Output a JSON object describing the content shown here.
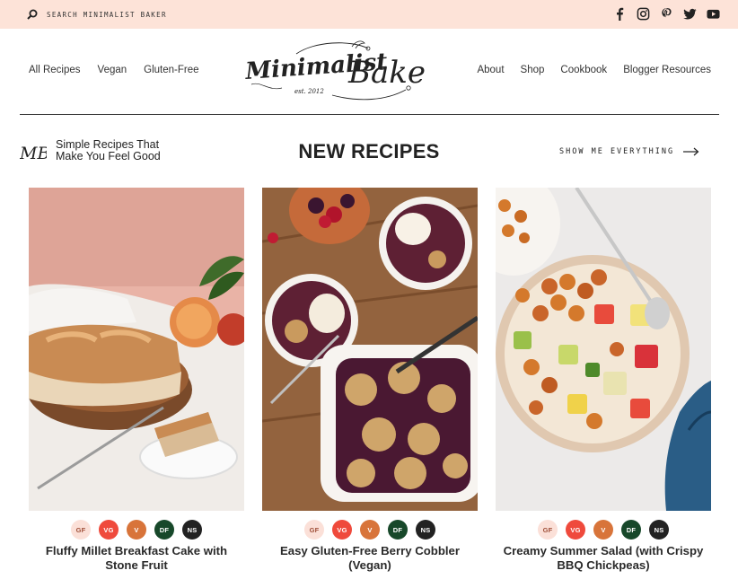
{
  "topbar": {
    "search_placeholder": "SEARCH MINIMALIST BAKER",
    "social": [
      {
        "name": "facebook-icon"
      },
      {
        "name": "instagram-icon"
      },
      {
        "name": "pinterest-icon"
      },
      {
        "name": "twitter-icon"
      },
      {
        "name": "youtube-icon"
      }
    ],
    "background_color": "#fde3d8"
  },
  "nav": {
    "left": [
      "All Recipes",
      "Vegan",
      "Gluten-Free"
    ],
    "right": [
      "About",
      "Shop",
      "Cookbook",
      "Blogger Resources"
    ]
  },
  "logo": {
    "word1": "Minimalist",
    "word2": "Baker",
    "est": "est. 2012"
  },
  "section": {
    "mark": "MB",
    "tagline_line1": "Simple Recipes That",
    "tagline_line2": "Make You Feel Good",
    "title": "NEW RECIPES",
    "show_all": "SHOW ME EVERYTHING"
  },
  "badge_colors": {
    "GF": "#fbe0d8",
    "VG": "#ef4a3c",
    "V": "#d8743a",
    "DF": "#17482a",
    "NS": "#222222"
  },
  "recipes": [
    {
      "badges": [
        "GF",
        "VG",
        "V",
        "DF",
        "NS"
      ],
      "title_line1": "Fluffy Millet Breakfast Cake with",
      "title_line2": "Stone Fruit"
    },
    {
      "badges": [
        "GF",
        "VG",
        "V",
        "DF",
        "NS"
      ],
      "title_line1": "Easy Gluten-Free Berry Cobbler",
      "title_line2": "(Vegan)"
    },
    {
      "badges": [
        "GF",
        "VG",
        "V",
        "DF",
        "NS"
      ],
      "title_line1": "Creamy Summer Salad (with Crispy",
      "title_line2": "BBQ Chickpeas)"
    }
  ]
}
